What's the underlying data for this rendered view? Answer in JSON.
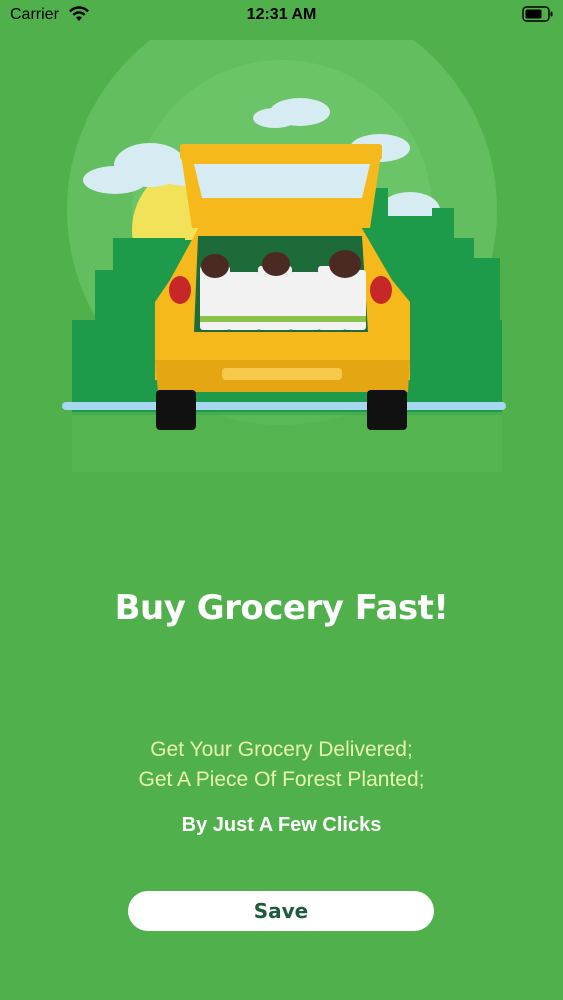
{
  "status_bar": {
    "carrier": "Carrier",
    "time": "12:31 AM",
    "wifi_icon": "wifi-icon",
    "battery_icon": "battery-icon"
  },
  "illustration": {
    "description_icon": "grocery-car-illustration",
    "colors": {
      "background": "#50B14C",
      "car_body": "#F6B91B",
      "buildings": "#1E9B4A",
      "sun": "#F2E25A"
    }
  },
  "onboarding": {
    "headline": "Buy Grocery Fast!",
    "tagline_line1": "Get Your Grocery Delivered;",
    "tagline_line2": "Get A Piece Of Forest Planted;",
    "subline": "By Just A Few Clicks"
  },
  "actions": {
    "save_label": "Save"
  },
  "colors": {
    "accent_text": "#E8F5A8",
    "button_text": "#1E5A3C",
    "button_bg": "#ffffff"
  }
}
